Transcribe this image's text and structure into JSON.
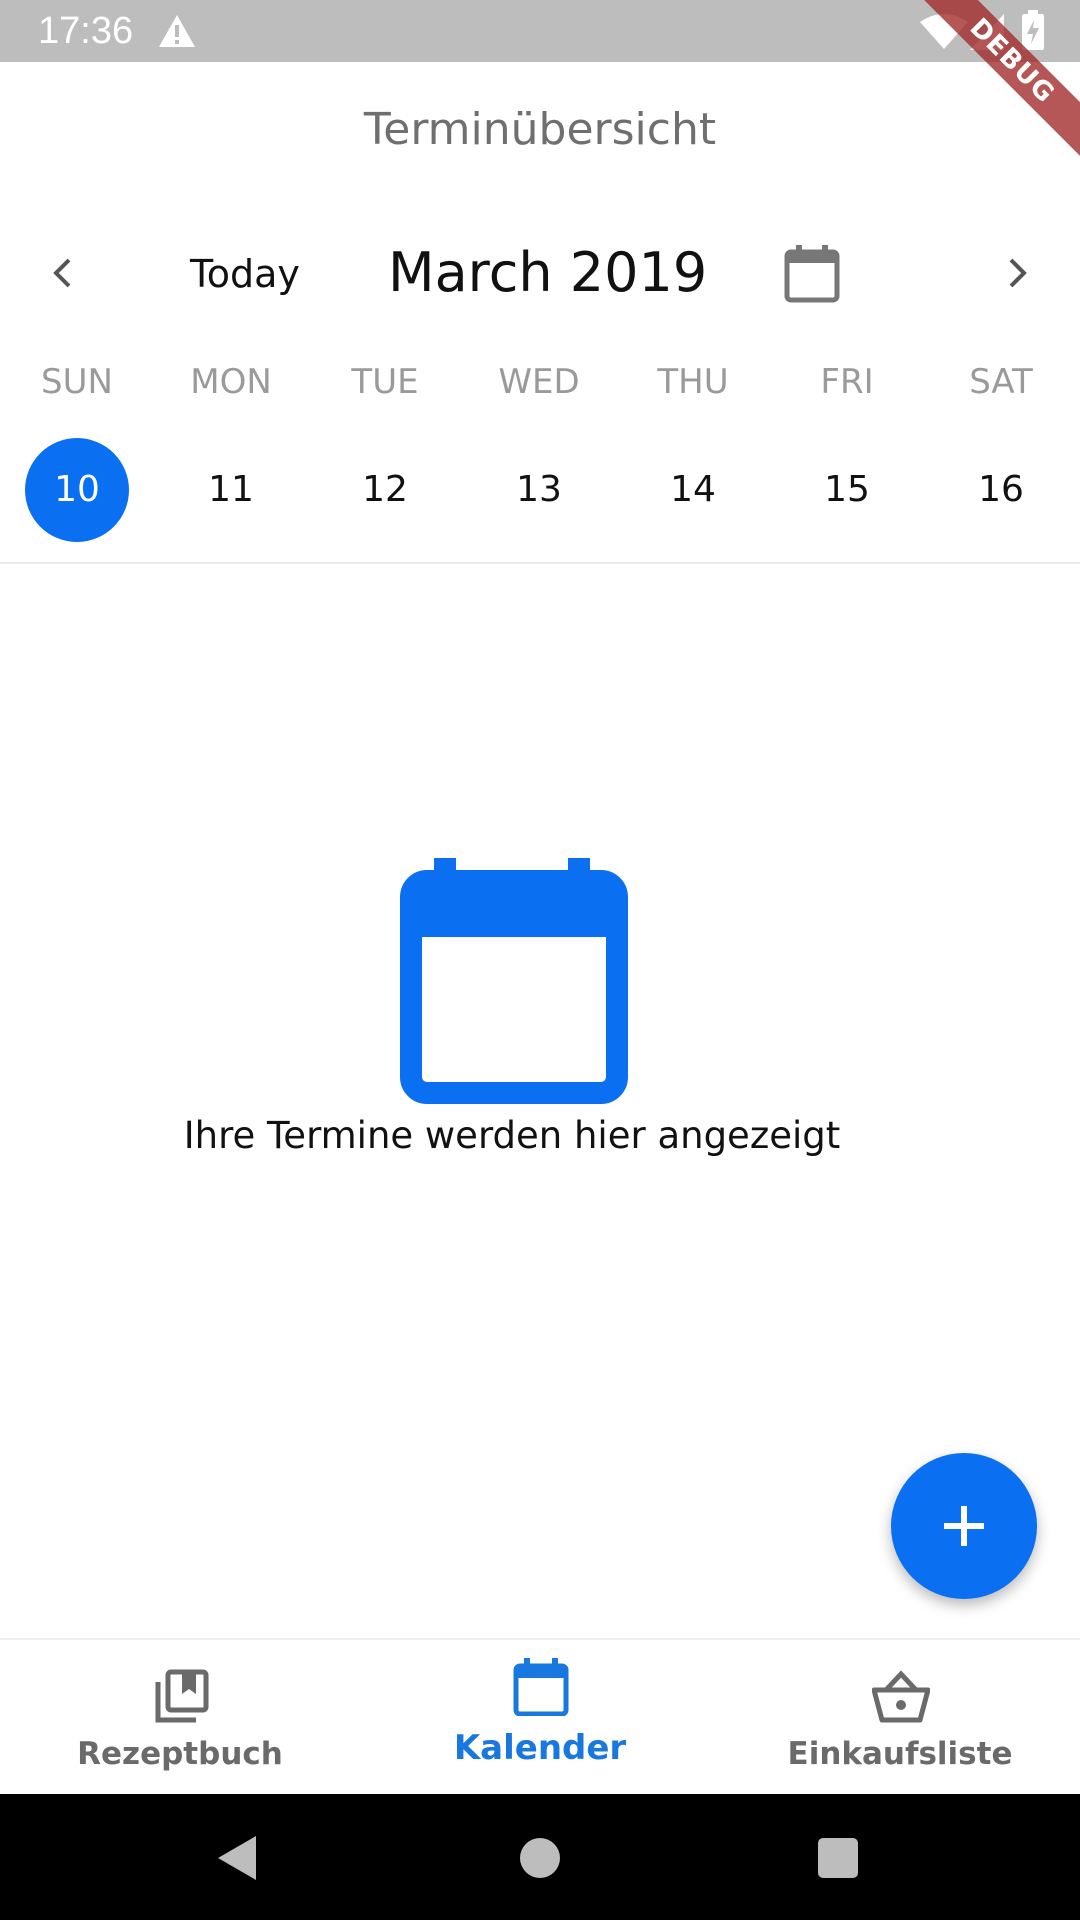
{
  "status_bar": {
    "time": "17:36",
    "icons": [
      "warning-icon",
      "wifi-icon",
      "signal-icon",
      "battery-icon"
    ]
  },
  "debug_banner": "DEBUG",
  "app_bar": {
    "title": "Terminübersicht"
  },
  "calendar": {
    "today_label": "Today",
    "month_label": "March 2019",
    "weekdays": [
      "SUN",
      "MON",
      "TUE",
      "WED",
      "THU",
      "FRI",
      "SAT"
    ],
    "dates": [
      "10",
      "11",
      "12",
      "13",
      "14",
      "15",
      "16"
    ],
    "selected_date": "10"
  },
  "empty_state": {
    "icon": "calendar-icon",
    "message": "Ihre Termine werden hier angezeigt"
  },
  "fab": {
    "icon": "plus-icon",
    "accent": "#0a6ff0"
  },
  "bottom_nav": {
    "items": [
      {
        "label": "Rezeptbuch",
        "icon": "book-icon",
        "active": false
      },
      {
        "label": "Kalender",
        "icon": "calendar-icon",
        "active": true
      },
      {
        "label": "Einkaufsliste",
        "icon": "basket-icon",
        "active": false
      }
    ]
  },
  "colors": {
    "accent": "#0a6ff0",
    "status_bar": "#bdbdbd",
    "nav_active": "#1878e0",
    "nav_inactive": "#6a6a6a"
  }
}
